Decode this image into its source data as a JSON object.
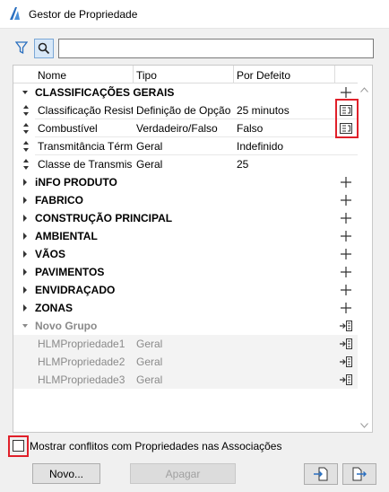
{
  "window": {
    "title": "Gestor de Propriedade"
  },
  "search": {
    "value": "",
    "placeholder": ""
  },
  "columns": {
    "name": "Nome",
    "type": "Tipo",
    "default": "Por Defeito"
  },
  "group_classificacoes": {
    "name": "CLASSIFICAÇÕES GERAIS"
  },
  "properties": [
    {
      "name": "Classificação Resist...",
      "type": "Definição de Opção",
      "default": "25 minutos"
    },
    {
      "name": "Combustível",
      "type": "Verdadeiro/Falso",
      "default": "Falso"
    },
    {
      "name": "Transmitância Térmi...",
      "type": "Geral",
      "default": "Indefinido"
    },
    {
      "name": "Classe de Transmis...",
      "type": "Geral",
      "default": "25"
    }
  ],
  "groups": [
    {
      "name": "iNFO PRODUTO"
    },
    {
      "name": "FABRICO"
    },
    {
      "name": "CONSTRUÇÃO PRINCIPAL"
    },
    {
      "name": "AMBIENTAL"
    },
    {
      "name": "VÃOS"
    },
    {
      "name": "PAVIMENTOS"
    },
    {
      "name": "ENVIDRAÇADO"
    },
    {
      "name": "ZONAS"
    }
  ],
  "novo_grupo": {
    "name": "Novo Grupo"
  },
  "hlm_properties": [
    {
      "name": "HLMPropriedade1",
      "type": "Geral"
    },
    {
      "name": "HLMPropriedade2",
      "type": "Geral"
    },
    {
      "name": "HLMPropriedade3",
      "type": "Geral"
    }
  ],
  "footer": {
    "checkbox_label": "Mostrar conflitos com Propriedades nas Associações",
    "checkbox_checked": false,
    "new_button": "Novo...",
    "delete_button": "Apagar"
  },
  "icons": {
    "app": "archicad-icon",
    "filter": "filter-icon",
    "search": "search-icon",
    "add": "plus-icon",
    "assign": "assign-property-icon",
    "import": "import-icon",
    "export": "export-icon"
  },
  "colors": {
    "highlight": "#e0202a",
    "search_active": "#d8e8f8"
  }
}
